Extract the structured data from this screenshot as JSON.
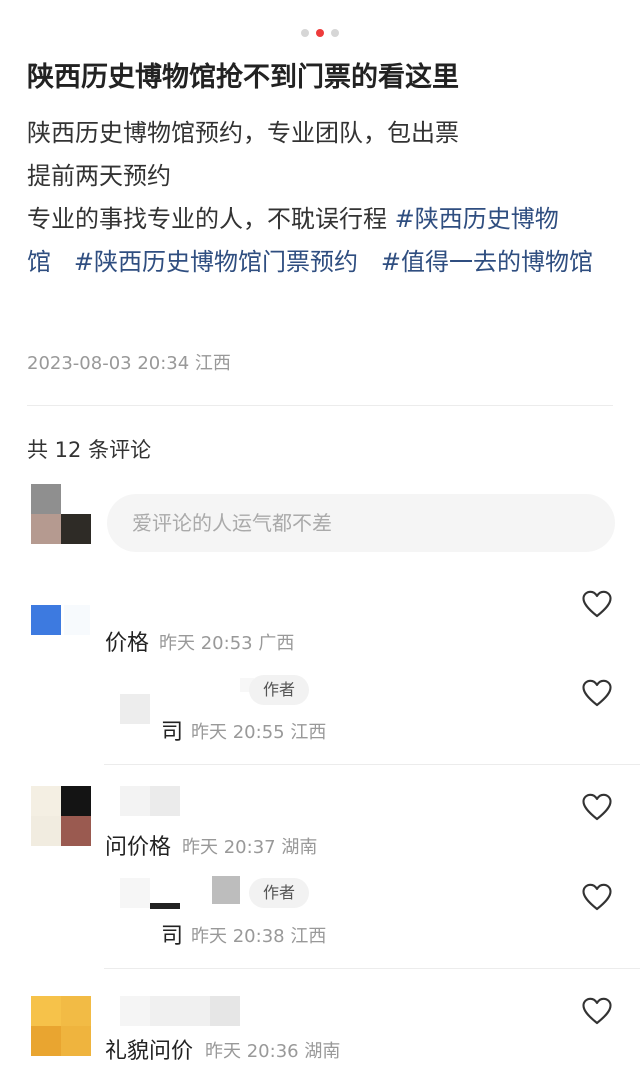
{
  "carousel": {
    "dots": 3,
    "active_index": 1
  },
  "post": {
    "title": "陕西历史博物馆抢不到门票的看这里",
    "lines": [
      "陕西历史博物馆预约，专业团队，包出票",
      "提前两天预约"
    ],
    "line3_text": "专业的事找专业的人，不耽误行程 ",
    "tags": [
      "#陕西历史博物馆",
      "#陕西历史博物馆门票预约",
      "#值得一去的博物馆"
    ],
    "meta": "2023-08-03 20:34 江西"
  },
  "comments_header": "共 12 条评论",
  "input_placeholder": "爱评论的人运气都不差",
  "comments": [
    {
      "text": "价格",
      "time": "昨天 20:53 广西",
      "reply": {
        "badge": "作者",
        "text": "司",
        "time": "昨天 20:55 江西"
      }
    },
    {
      "text": "问价格",
      "time": "昨天 20:37 湖南",
      "reply": {
        "badge": "作者",
        "text": "司",
        "time": "昨天 20:38 江西"
      }
    },
    {
      "text": "礼貌问价",
      "time": "昨天 20:36 湖南"
    }
  ],
  "colors": {
    "accent_dot": "#ee3b3b",
    "hashtag": "#2f4e80",
    "meta_gray": "#999999"
  },
  "icons": {
    "like": "heart-outline-icon"
  }
}
